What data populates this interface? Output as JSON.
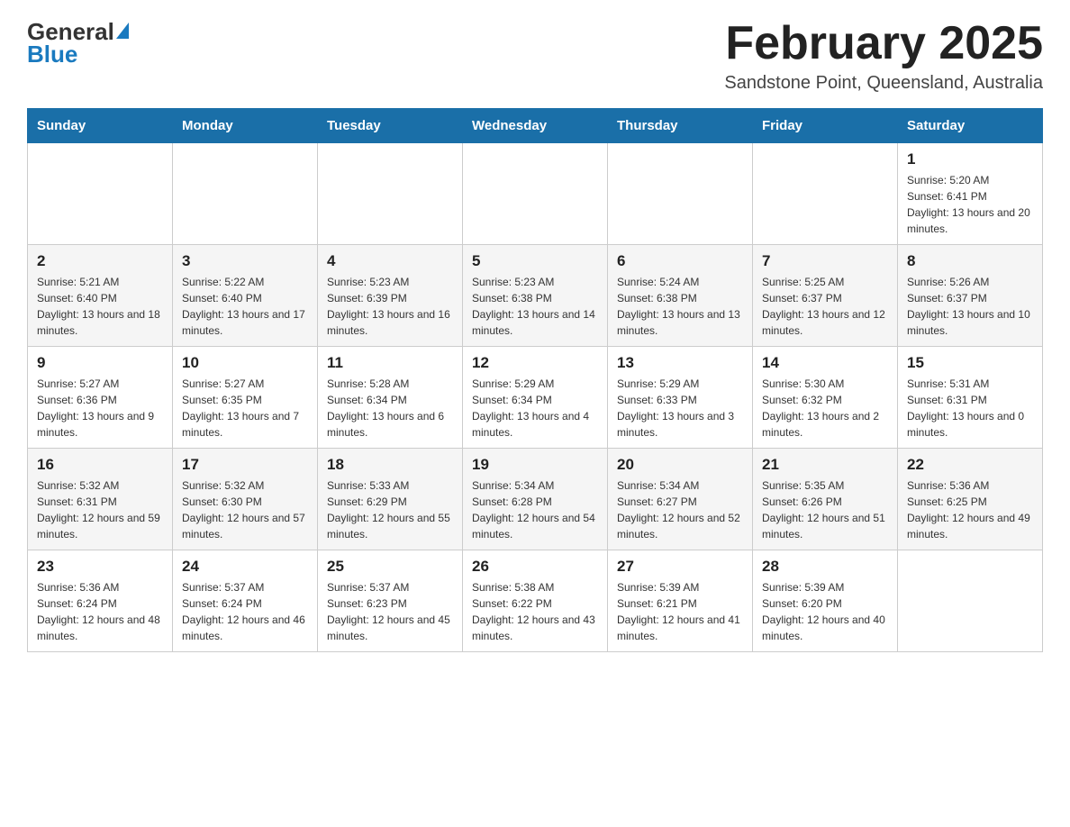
{
  "header": {
    "logo_general": "General",
    "logo_blue": "Blue",
    "title": "February 2025",
    "subtitle": "Sandstone Point, Queensland, Australia"
  },
  "days_of_week": [
    "Sunday",
    "Monday",
    "Tuesday",
    "Wednesday",
    "Thursday",
    "Friday",
    "Saturday"
  ],
  "weeks": [
    [
      {
        "day": "",
        "info": ""
      },
      {
        "day": "",
        "info": ""
      },
      {
        "day": "",
        "info": ""
      },
      {
        "day": "",
        "info": ""
      },
      {
        "day": "",
        "info": ""
      },
      {
        "day": "",
        "info": ""
      },
      {
        "day": "1",
        "info": "Sunrise: 5:20 AM\nSunset: 6:41 PM\nDaylight: 13 hours and 20 minutes."
      }
    ],
    [
      {
        "day": "2",
        "info": "Sunrise: 5:21 AM\nSunset: 6:40 PM\nDaylight: 13 hours and 18 minutes."
      },
      {
        "day": "3",
        "info": "Sunrise: 5:22 AM\nSunset: 6:40 PM\nDaylight: 13 hours and 17 minutes."
      },
      {
        "day": "4",
        "info": "Sunrise: 5:23 AM\nSunset: 6:39 PM\nDaylight: 13 hours and 16 minutes."
      },
      {
        "day": "5",
        "info": "Sunrise: 5:23 AM\nSunset: 6:38 PM\nDaylight: 13 hours and 14 minutes."
      },
      {
        "day": "6",
        "info": "Sunrise: 5:24 AM\nSunset: 6:38 PM\nDaylight: 13 hours and 13 minutes."
      },
      {
        "day": "7",
        "info": "Sunrise: 5:25 AM\nSunset: 6:37 PM\nDaylight: 13 hours and 12 minutes."
      },
      {
        "day": "8",
        "info": "Sunrise: 5:26 AM\nSunset: 6:37 PM\nDaylight: 13 hours and 10 minutes."
      }
    ],
    [
      {
        "day": "9",
        "info": "Sunrise: 5:27 AM\nSunset: 6:36 PM\nDaylight: 13 hours and 9 minutes."
      },
      {
        "day": "10",
        "info": "Sunrise: 5:27 AM\nSunset: 6:35 PM\nDaylight: 13 hours and 7 minutes."
      },
      {
        "day": "11",
        "info": "Sunrise: 5:28 AM\nSunset: 6:34 PM\nDaylight: 13 hours and 6 minutes."
      },
      {
        "day": "12",
        "info": "Sunrise: 5:29 AM\nSunset: 6:34 PM\nDaylight: 13 hours and 4 minutes."
      },
      {
        "day": "13",
        "info": "Sunrise: 5:29 AM\nSunset: 6:33 PM\nDaylight: 13 hours and 3 minutes."
      },
      {
        "day": "14",
        "info": "Sunrise: 5:30 AM\nSunset: 6:32 PM\nDaylight: 13 hours and 2 minutes."
      },
      {
        "day": "15",
        "info": "Sunrise: 5:31 AM\nSunset: 6:31 PM\nDaylight: 13 hours and 0 minutes."
      }
    ],
    [
      {
        "day": "16",
        "info": "Sunrise: 5:32 AM\nSunset: 6:31 PM\nDaylight: 12 hours and 59 minutes."
      },
      {
        "day": "17",
        "info": "Sunrise: 5:32 AM\nSunset: 6:30 PM\nDaylight: 12 hours and 57 minutes."
      },
      {
        "day": "18",
        "info": "Sunrise: 5:33 AM\nSunset: 6:29 PM\nDaylight: 12 hours and 55 minutes."
      },
      {
        "day": "19",
        "info": "Sunrise: 5:34 AM\nSunset: 6:28 PM\nDaylight: 12 hours and 54 minutes."
      },
      {
        "day": "20",
        "info": "Sunrise: 5:34 AM\nSunset: 6:27 PM\nDaylight: 12 hours and 52 minutes."
      },
      {
        "day": "21",
        "info": "Sunrise: 5:35 AM\nSunset: 6:26 PM\nDaylight: 12 hours and 51 minutes."
      },
      {
        "day": "22",
        "info": "Sunrise: 5:36 AM\nSunset: 6:25 PM\nDaylight: 12 hours and 49 minutes."
      }
    ],
    [
      {
        "day": "23",
        "info": "Sunrise: 5:36 AM\nSunset: 6:24 PM\nDaylight: 12 hours and 48 minutes."
      },
      {
        "day": "24",
        "info": "Sunrise: 5:37 AM\nSunset: 6:24 PM\nDaylight: 12 hours and 46 minutes."
      },
      {
        "day": "25",
        "info": "Sunrise: 5:37 AM\nSunset: 6:23 PM\nDaylight: 12 hours and 45 minutes."
      },
      {
        "day": "26",
        "info": "Sunrise: 5:38 AM\nSunset: 6:22 PM\nDaylight: 12 hours and 43 minutes."
      },
      {
        "day": "27",
        "info": "Sunrise: 5:39 AM\nSunset: 6:21 PM\nDaylight: 12 hours and 41 minutes."
      },
      {
        "day": "28",
        "info": "Sunrise: 5:39 AM\nSunset: 6:20 PM\nDaylight: 12 hours and 40 minutes."
      },
      {
        "day": "",
        "info": ""
      }
    ]
  ]
}
